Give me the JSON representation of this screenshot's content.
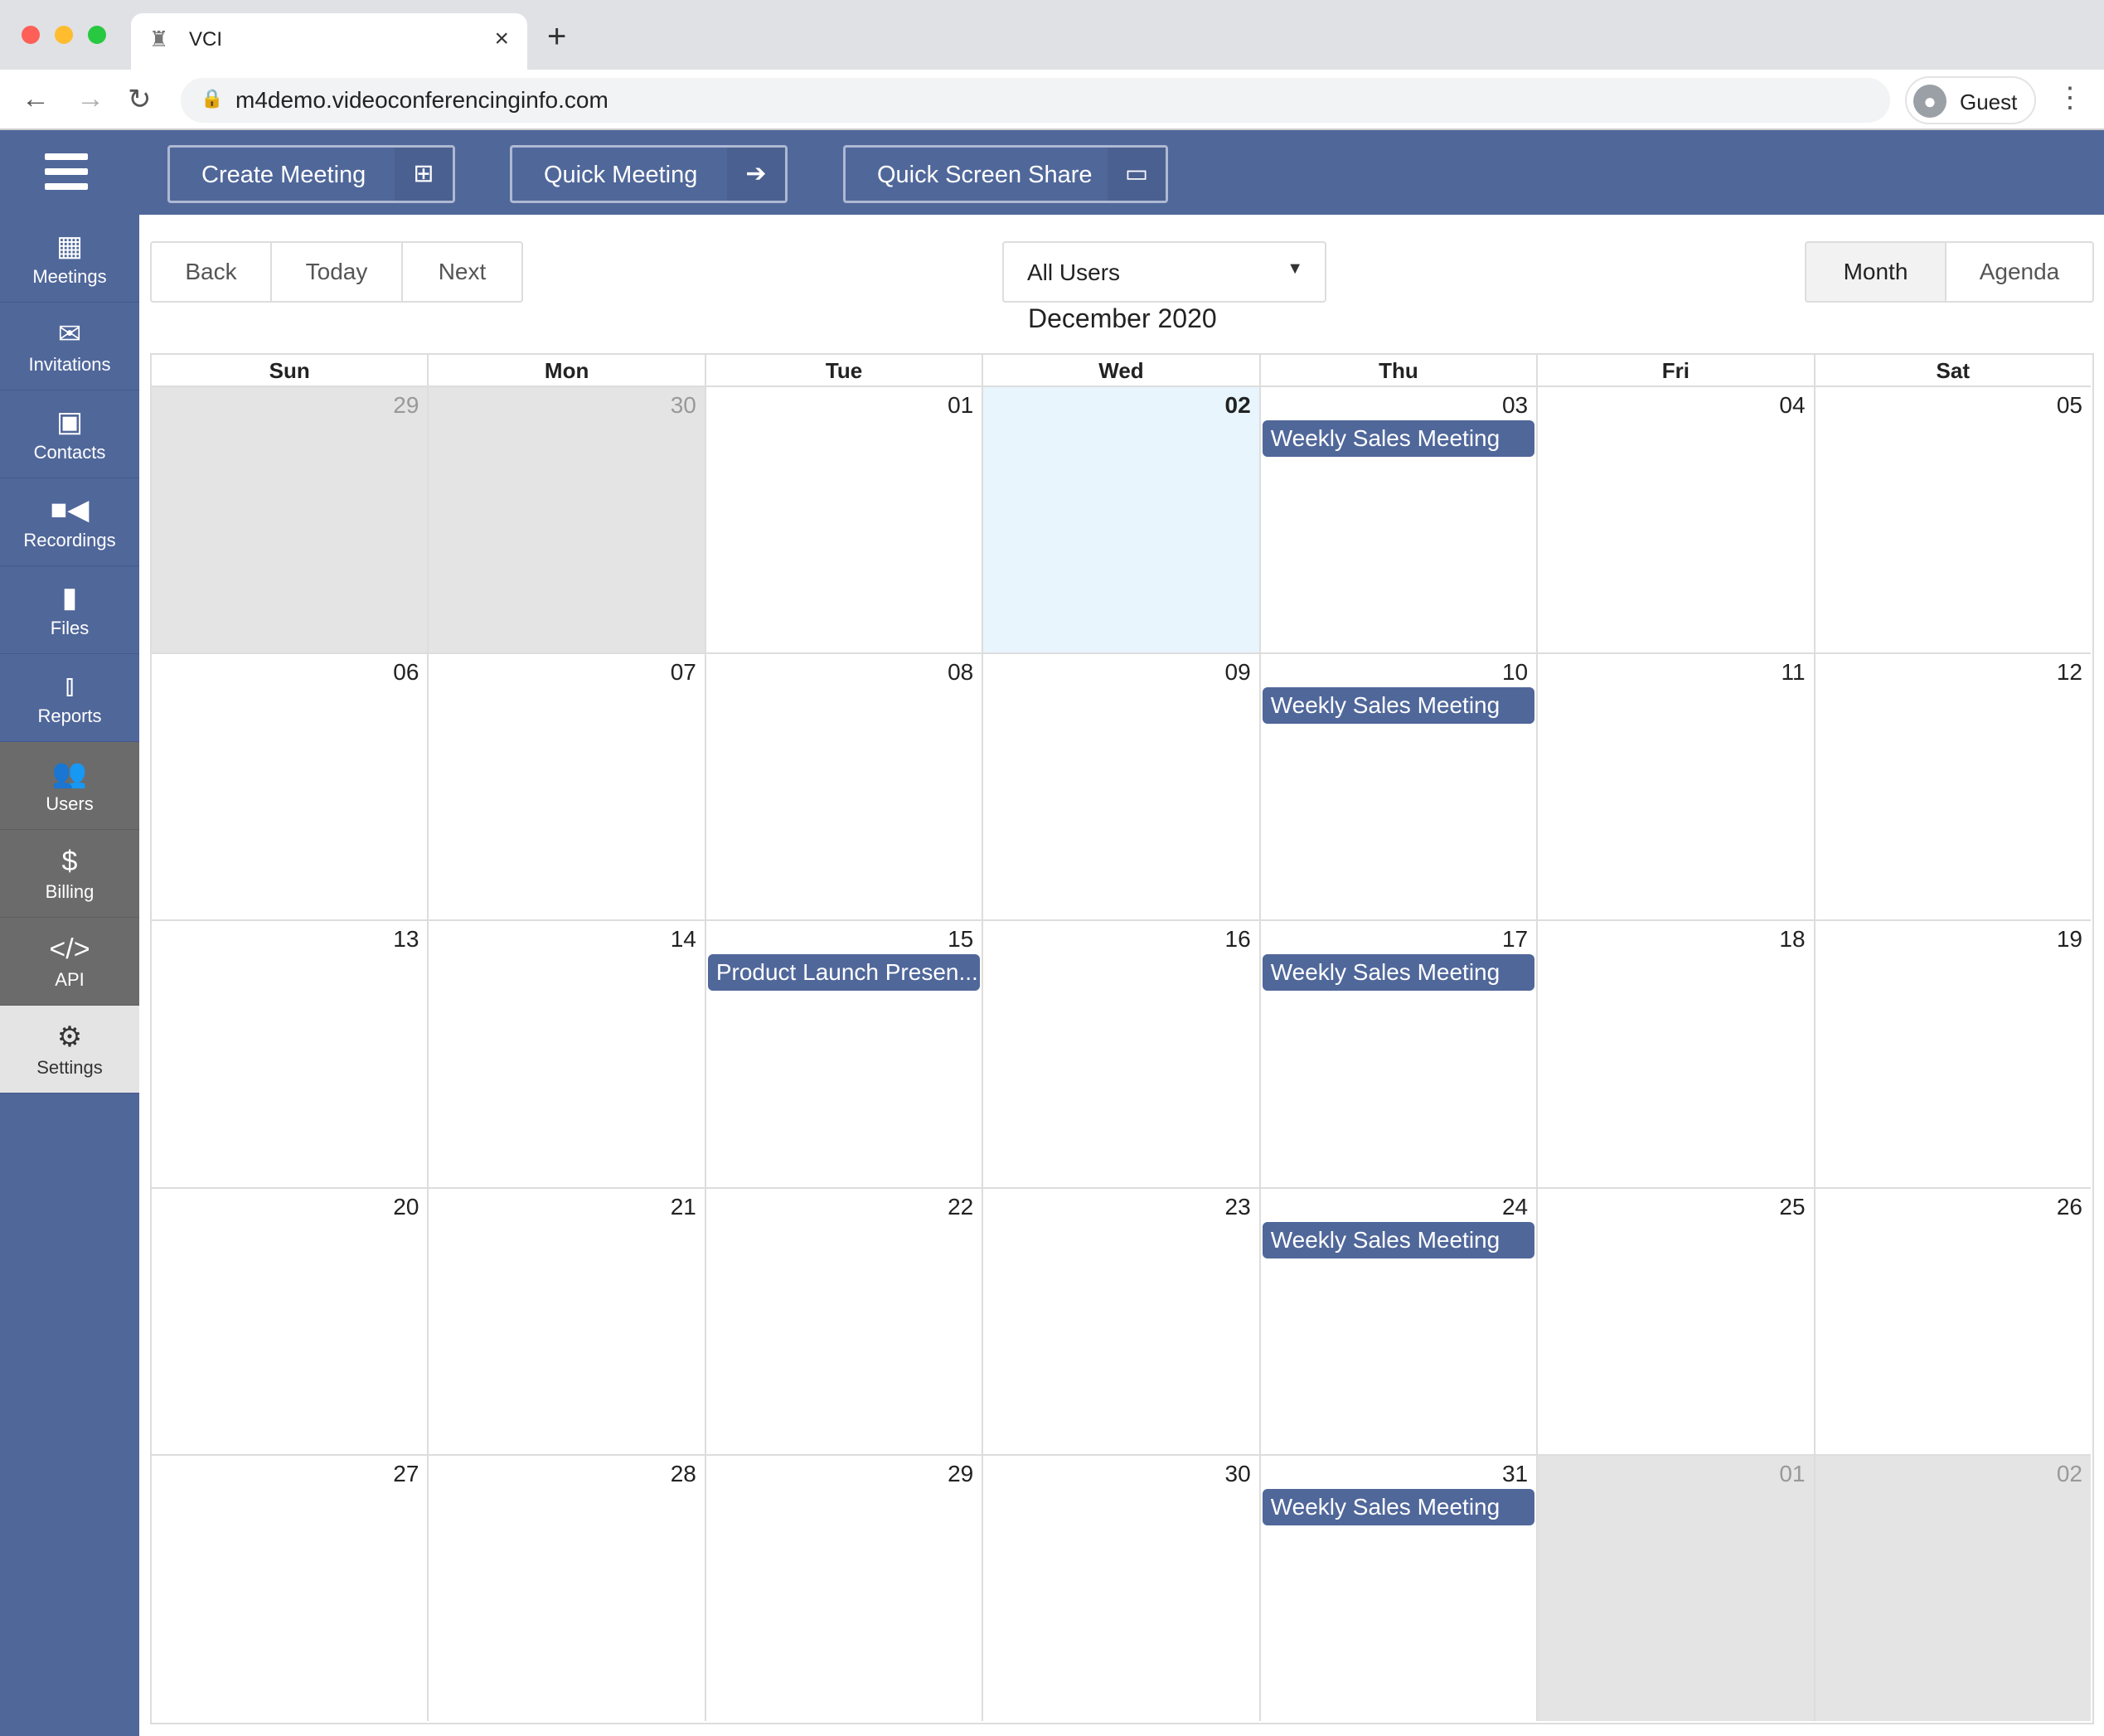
{
  "browser": {
    "tab_title": "VCI",
    "url": "m4demo.videoconferencinginfo.com",
    "profile": "Guest"
  },
  "header": {
    "buttons": [
      {
        "label": "Create Meeting",
        "icon": "calendar-plus-icon"
      },
      {
        "label": "Quick Meeting",
        "icon": "arrow-right-icon"
      },
      {
        "label": "Quick Screen Share",
        "icon": "monitor-icon"
      }
    ]
  },
  "sidebar": {
    "items": [
      {
        "label": "Meetings",
        "icon": "calendar-icon",
        "glyph": "▦",
        "style": "blue"
      },
      {
        "label": "Invitations",
        "icon": "envelope-icon",
        "glyph": "✉",
        "style": "blue"
      },
      {
        "label": "Contacts",
        "icon": "address-book-icon",
        "glyph": "▣",
        "style": "blue"
      },
      {
        "label": "Recordings",
        "icon": "video-camera-icon",
        "glyph": "■◀",
        "style": "blue"
      },
      {
        "label": "Files",
        "icon": "file-icon",
        "glyph": "▮",
        "style": "blue"
      },
      {
        "label": "Reports",
        "icon": "bar-chart-icon",
        "glyph": "⫾",
        "style": "blue"
      },
      {
        "label": "Users",
        "icon": "users-icon",
        "glyph": "👥",
        "style": "gray"
      },
      {
        "label": "Billing",
        "icon": "dollar-icon",
        "glyph": "$",
        "style": "gray"
      },
      {
        "label": "API",
        "icon": "code-icon",
        "glyph": "</>",
        "style": "gray"
      },
      {
        "label": "Settings",
        "icon": "gears-icon",
        "glyph": "⚙",
        "style": "light"
      }
    ]
  },
  "toolbar": {
    "back": "Back",
    "today": "Today",
    "next": "Next",
    "user_filter": "All Users",
    "views": [
      {
        "label": "Month",
        "active": true
      },
      {
        "label": "Agenda",
        "active": false
      }
    ]
  },
  "calendar": {
    "title": "December 2020",
    "weekdays": [
      "Sun",
      "Mon",
      "Tue",
      "Wed",
      "Thu",
      "Fri",
      "Sat"
    ],
    "colors": {
      "event": "#50679a",
      "today": "#e8f5fd",
      "off_month": "#e4e4e4"
    },
    "weeks": [
      [
        {
          "d": "29",
          "off": true
        },
        {
          "d": "30",
          "off": true
        },
        {
          "d": "01"
        },
        {
          "d": "02",
          "today": true
        },
        {
          "d": "03",
          "events": [
            "Weekly Sales Meeting"
          ]
        },
        {
          "d": "04"
        },
        {
          "d": "05"
        }
      ],
      [
        {
          "d": "06"
        },
        {
          "d": "07"
        },
        {
          "d": "08"
        },
        {
          "d": "09"
        },
        {
          "d": "10",
          "events": [
            "Weekly Sales Meeting"
          ]
        },
        {
          "d": "11"
        },
        {
          "d": "12"
        }
      ],
      [
        {
          "d": "13"
        },
        {
          "d": "14"
        },
        {
          "d": "15",
          "events": [
            "Product Launch Presen..."
          ]
        },
        {
          "d": "16"
        },
        {
          "d": "17",
          "events": [
            "Weekly Sales Meeting"
          ]
        },
        {
          "d": "18"
        },
        {
          "d": "19"
        }
      ],
      [
        {
          "d": "20"
        },
        {
          "d": "21"
        },
        {
          "d": "22"
        },
        {
          "d": "23"
        },
        {
          "d": "24",
          "events": [
            "Weekly Sales Meeting"
          ]
        },
        {
          "d": "25"
        },
        {
          "d": "26"
        }
      ],
      [
        {
          "d": "27"
        },
        {
          "d": "28"
        },
        {
          "d": "29"
        },
        {
          "d": "30"
        },
        {
          "d": "31",
          "events": [
            "Weekly Sales Meeting"
          ]
        },
        {
          "d": "01",
          "off": true
        },
        {
          "d": "02",
          "off": true
        }
      ]
    ]
  }
}
